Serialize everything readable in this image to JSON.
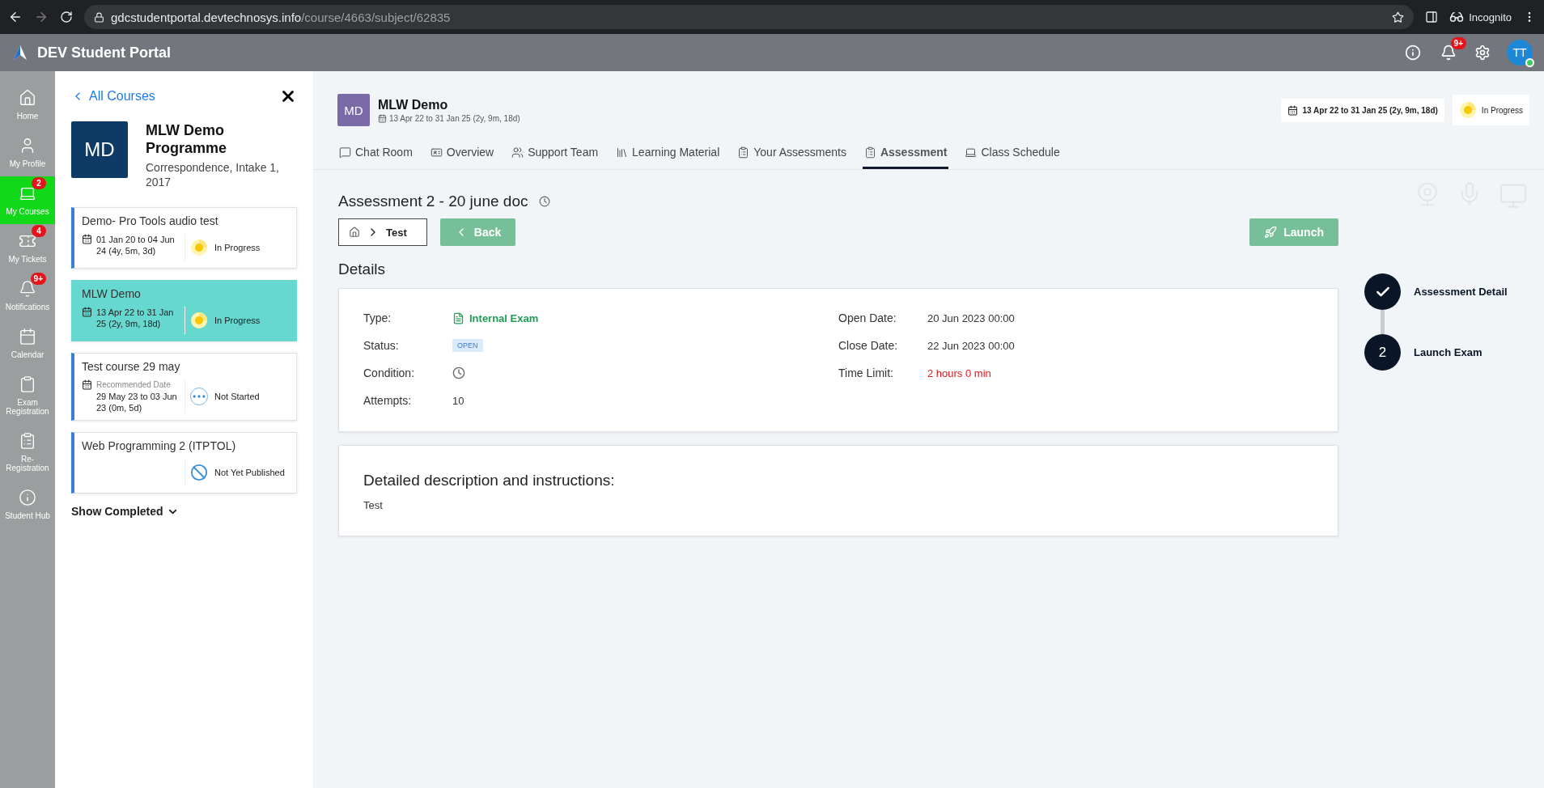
{
  "browser": {
    "url_host": "gdcstudentportal.devtechnosys.info",
    "url_path": "/course/4663/subject/62835",
    "profile": "Incognito"
  },
  "app_header": {
    "title": "DEV Student Portal",
    "notification_badge": "9+",
    "avatar": "TT"
  },
  "nav": [
    {
      "label": "Home",
      "selected": false
    },
    {
      "label": "My Profile",
      "selected": false
    },
    {
      "label": "My Courses",
      "badge": "2",
      "selected": true
    },
    {
      "label": "My Tickets",
      "badge": "4",
      "selected": false
    },
    {
      "label": "Notifications",
      "badge": "9+",
      "selected": false
    },
    {
      "label": "Calendar",
      "selected": false
    },
    {
      "label": "Exam Registration",
      "selected": false
    },
    {
      "label": "Re-Registration",
      "selected": false
    },
    {
      "label": "Student Hub",
      "selected": false
    }
  ],
  "course_panel": {
    "back_link": "All Courses",
    "programme": {
      "initials": "MD",
      "title": "MLW Demo Programme",
      "subtitle": "Correspondence, Intake 1, 2017"
    },
    "courses": [
      {
        "title": "Demo- Pro Tools audio test",
        "dates": "01 Jan 20 to 04 Jun 24 (4y, 5m, 3d)",
        "status": "In Progress",
        "kind": "in_progress",
        "selected": false
      },
      {
        "title": "MLW Demo",
        "dates": "13 Apr 22 to 31 Jan 25 (2y, 9m, 18d)",
        "status": "In Progress",
        "kind": "in_progress",
        "selected": true
      },
      {
        "title": "Test course 29 may",
        "date_note": "Recommended Date",
        "dates": "29 May 23 to 03 Jun 23 (0m, 5d)",
        "status": "Not Started",
        "kind": "not_started",
        "selected": false
      },
      {
        "title": "Web Programming 2 (ITPTOL)",
        "status": "Not Yet Published",
        "kind": "not_published",
        "selected": false
      }
    ],
    "show_completed": "Show Completed"
  },
  "subject": {
    "initials": "MD",
    "title": "MLW Demo",
    "dates": "13 Apr 22 to 31 Jan 25 (2y, 9m, 18d)",
    "date_chip": "13 Apr 22 to 31 Jan 25 (2y, 9m, 18d)",
    "status_chip": "In Progress"
  },
  "tabs": [
    {
      "label": "Chat Room",
      "selected": false
    },
    {
      "label": "Overview",
      "selected": false
    },
    {
      "label": "Support Team",
      "selected": false
    },
    {
      "label": "Learning Material",
      "selected": false
    },
    {
      "label": "Your Assessments",
      "selected": false
    },
    {
      "label": "Assessment",
      "selected": true
    },
    {
      "label": "Class Schedule",
      "selected": false
    }
  ],
  "assessment": {
    "title": "Assessment 2 - 20 june doc",
    "breadcrumb": "Test",
    "back_button": "Back",
    "launch_button": "Launch",
    "details_heading": "Details",
    "details_left": [
      {
        "label": "Type:",
        "value": "Internal Exam",
        "kind": "type"
      },
      {
        "label": "Status:",
        "value": "OPEN",
        "kind": "badge"
      },
      {
        "label": "Condition:",
        "kind": "clock"
      },
      {
        "label": "Attempts:",
        "value": "10",
        "kind": "text"
      }
    ],
    "details_right": [
      {
        "label": "Open Date:",
        "value": "20 Jun 2023 00:00",
        "kind": "text"
      },
      {
        "label": "Close Date:",
        "value": "22 Jun 2023 00:00",
        "kind": "text"
      },
      {
        "label": "Time Limit:",
        "value": "2 hours 0 min",
        "kind": "alert"
      }
    ],
    "description_heading": "Detailed description and instructions:",
    "description": "Test"
  },
  "steps": [
    {
      "label": "Assessment Detail",
      "done": true
    },
    {
      "label": "Launch Exam",
      "number": "2",
      "done": false
    }
  ]
}
